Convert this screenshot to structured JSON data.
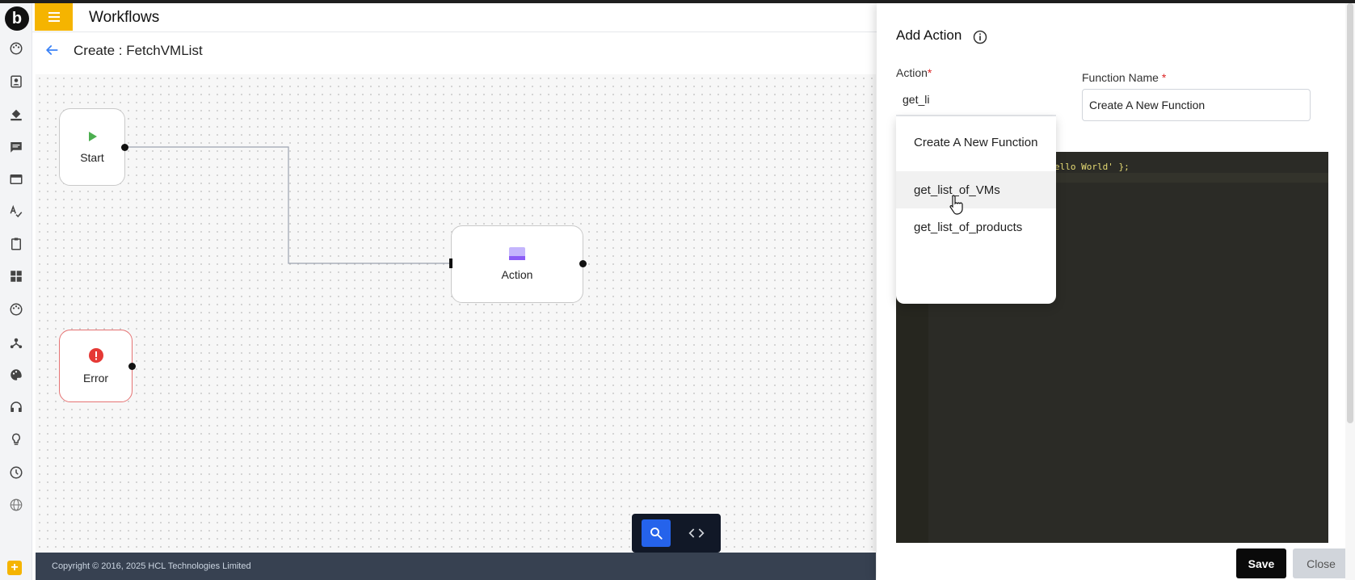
{
  "app": {
    "logo_letter": "b",
    "title": "Workflows"
  },
  "page": {
    "title": "Create : FetchVMList"
  },
  "rail": {
    "icons": [
      "palette-icon",
      "contact-icon",
      "paint-bucket-icon",
      "comment-icon",
      "panel-icon",
      "spellcheck-icon",
      "clipboard-icon",
      "dashboard-icon",
      "palette-icon",
      "hub-icon",
      "color-palette-icon",
      "headset-icon",
      "lightbulb-icon",
      "clock-icon",
      "globe-icon"
    ],
    "add_label": "+"
  },
  "canvas": {
    "nodes": {
      "start": "Start",
      "action": "Action",
      "error": "Error"
    },
    "colors": {
      "start_icon": "#4caf50",
      "action_icon": "#a78bfa",
      "error_icon": "#e53935",
      "error_border": "#e57373"
    }
  },
  "footer": {
    "copyright": "Copyright © 2016, 2025 HCL Technologies Limited"
  },
  "drawer": {
    "title": "Add Action",
    "action_label": "Action",
    "action_required": "*",
    "action_value": "get_li",
    "function_name_label": "Function Name",
    "function_name_required": "*",
    "function_name_value": "Create A New Function",
    "code_snippet": "ello World' };",
    "dropdown": {
      "items": [
        "Create A New Function",
        "get_list_of_VMs",
        "get_list_of_products"
      ],
      "hovered_index": 1
    },
    "save_label": "Save",
    "close_label": "Close"
  },
  "accent": {
    "brand": "#f5b400",
    "primary": "#2563eb"
  }
}
